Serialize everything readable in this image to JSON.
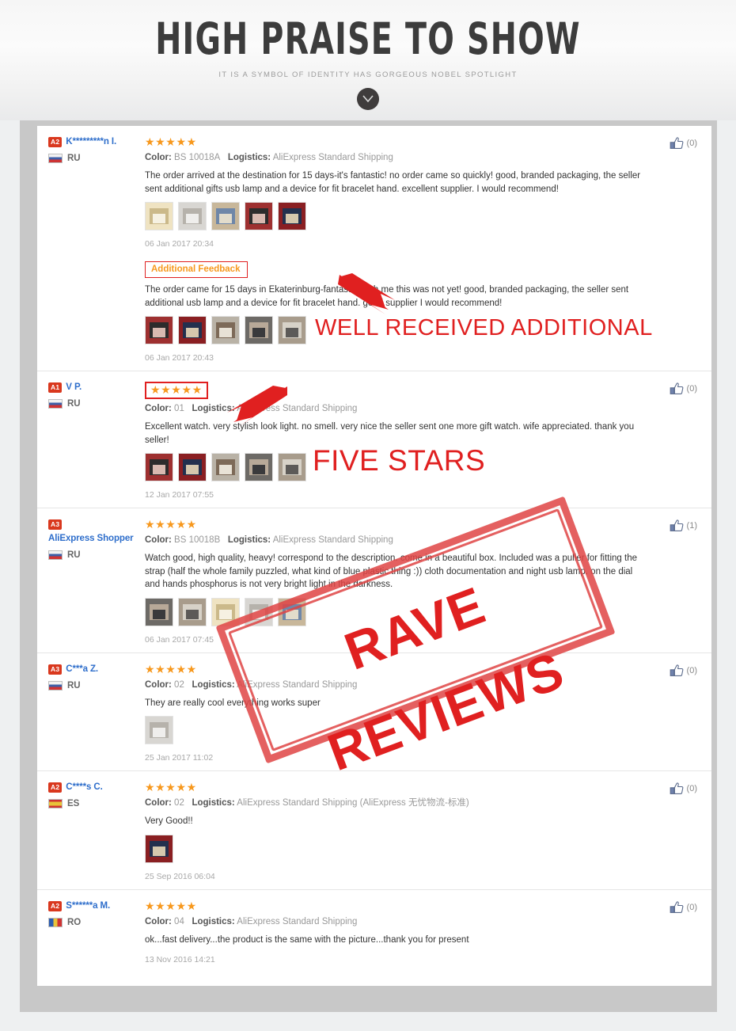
{
  "hero": {
    "title": "HIGH PRAISE TO SHOW",
    "subtitle": "IT IS A SYMBOL OF IDENTITY HAS GORGEOUS NOBEL SPOTLIGHT",
    "scroll_icon": "chevron-down-icon"
  },
  "labels": {
    "color": "Color:",
    "logistics": "Logistics:",
    "additional_feedback": "Additional Feedback",
    "stars": "★★★★★"
  },
  "annotations": {
    "arrow1": "red-arrow-icon",
    "arrow2": "red-arrow-icon",
    "well_received": "WELL RECEIVED ADDITIONAL",
    "five_stars": "FIVE STARS",
    "stamp": "RAVE REVIEWS"
  },
  "reviews": [
    {
      "level": "A2",
      "name": "K*********n I.",
      "country": "RU",
      "flag": "flag-ru",
      "stars": "★★★★★",
      "stars_boxed": false,
      "color": "BS 10018A",
      "logistics": "AliExpress Standard Shipping",
      "text": "The order arrived at the destination for 15 days-it's fantastic! no order came so quickly! good, branded packaging, the seller sent additional gifts usb lamp and a device for fit bracelet hand. excellent supplier. I would recommend!",
      "photos": 5,
      "date": "06 Jan 2017 20:34",
      "likes": "(0)",
      "additional": {
        "label": "Additional Feedback",
        "text": "The order came for 15 days in Ekaterinburg-fantastic! with me this was not yet! good, branded packaging, the seller sent additional usb lamp and a device for fit bracelet hand. good supplier I would recommend!",
        "photos": 5,
        "date": "06 Jan 2017 20:43"
      }
    },
    {
      "level": "A1",
      "name": "V P.",
      "country": "RU",
      "flag": "flag-ru",
      "stars": "★★★★★",
      "stars_boxed": true,
      "color": "01",
      "logistics": "AliExpress Standard Shipping",
      "text": "Excellent watch. very stylish look light. no smell. very nice the seller sent one more gift watch. wife appreciated. thank you seller!",
      "photos": 5,
      "date": "12 Jan 2017 07:55",
      "likes": "(0)"
    },
    {
      "level": "A3",
      "name": "AliExpress Shopper",
      "country": "RU",
      "flag": "flag-ru",
      "stars": "★★★★★",
      "stars_boxed": false,
      "color": "BS 10018B",
      "logistics": "AliExpress Standard Shipping",
      "text": "Watch good, high quality, heavy! correspond to the description. come in a beautiful box. Included was a puller for fitting the strap (half the whole family puzzled, what kind of blue plastic thing :)) cloth documentation and night usb lamp. on the dial and hands phosphorus is not very bright light in the darkness.",
      "photos": 5,
      "date": "06 Jan 2017 07:45",
      "likes": "(1)"
    },
    {
      "level": "A3",
      "name": "C***a Z.",
      "country": "RU",
      "flag": "flag-ru",
      "stars": "★★★★★",
      "stars_boxed": false,
      "color": "02",
      "logistics": "AliExpress Standard Shipping",
      "text": "They are really cool everything works super",
      "photos": 1,
      "date": "25 Jan 2017 11:02",
      "likes": "(0)"
    },
    {
      "level": "A2",
      "name": "C****s C.",
      "country": "ES",
      "flag": "flag-es",
      "stars": "★★★★★",
      "stars_boxed": false,
      "color": "02",
      "logistics": "AliExpress Standard Shipping (AliExpress 无忧物流-标准)",
      "text": "Very Good!!",
      "photos": 1,
      "date": "25 Sep 2016 06:04",
      "likes": "(0)"
    },
    {
      "level": "A2",
      "name": "S******a M.",
      "country": "RO",
      "flag": "flag-ro",
      "stars": "★★★★★",
      "stars_boxed": false,
      "color": "04",
      "logistics": "AliExpress Standard Shipping",
      "text": "ok...fast delivery...the product is the same with the picture...thank you for present",
      "photos": 0,
      "date": "13 Nov 2016 14:21",
      "likes": "(0)"
    }
  ],
  "colors": {
    "star": "#f7981d",
    "level_badge": "#d9381e",
    "username": "#2e6ecb",
    "annotation_red": "#e02020",
    "frame": "#c8c8c8"
  }
}
